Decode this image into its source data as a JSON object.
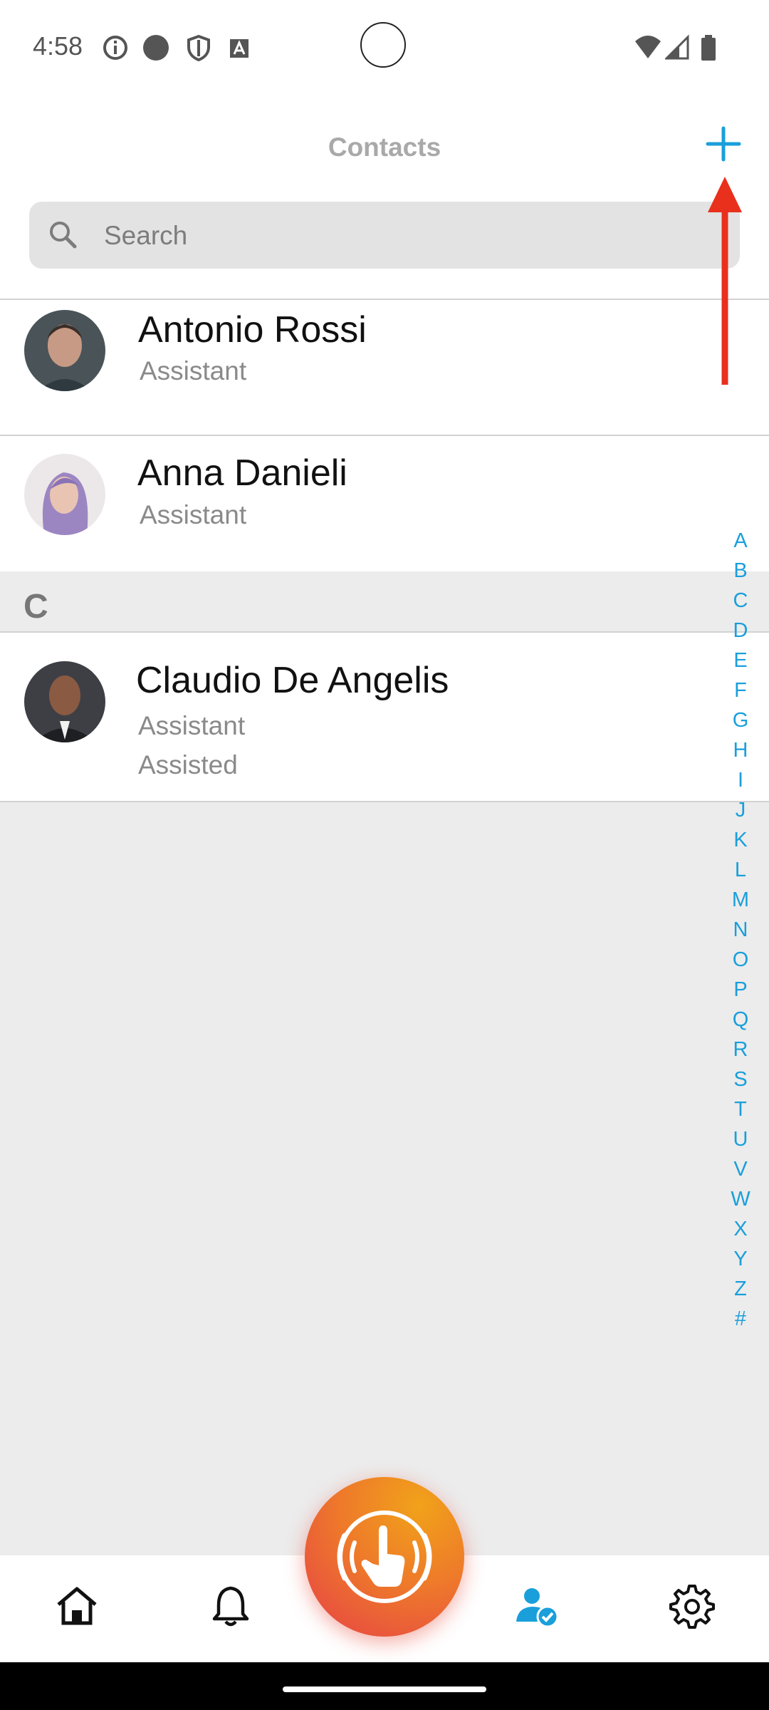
{
  "status_bar": {
    "time": "4:58"
  },
  "header": {
    "title": "Contacts"
  },
  "search": {
    "placeholder": "Search"
  },
  "contacts": [
    {
      "name": "Antonio Rossi",
      "role": "Assistant"
    },
    {
      "name": "Anna Danieli",
      "role": "Assistant"
    },
    {
      "name": "Claudio De Angelis",
      "role": "Assistant",
      "extra": "Assisted"
    }
  ],
  "section_header": "C",
  "alphabet_index": [
    "A",
    "B",
    "C",
    "D",
    "E",
    "F",
    "G",
    "H",
    "I",
    "J",
    "K",
    "L",
    "M",
    "N",
    "O",
    "P",
    "Q",
    "R",
    "S",
    "T",
    "U",
    "V",
    "W",
    "X",
    "Y",
    "Z",
    "#"
  ],
  "bottom_nav": {
    "items": [
      "home-icon",
      "bell-icon",
      "sos-touch-icon",
      "contacts-verified-icon",
      "gear-icon"
    ],
    "active": "contacts-verified-icon"
  },
  "colors": {
    "accent": "#1a9fdb",
    "annotation_arrow": "#e8301c",
    "fab_start": "#f1a21a",
    "fab_end": "#e64047"
  }
}
